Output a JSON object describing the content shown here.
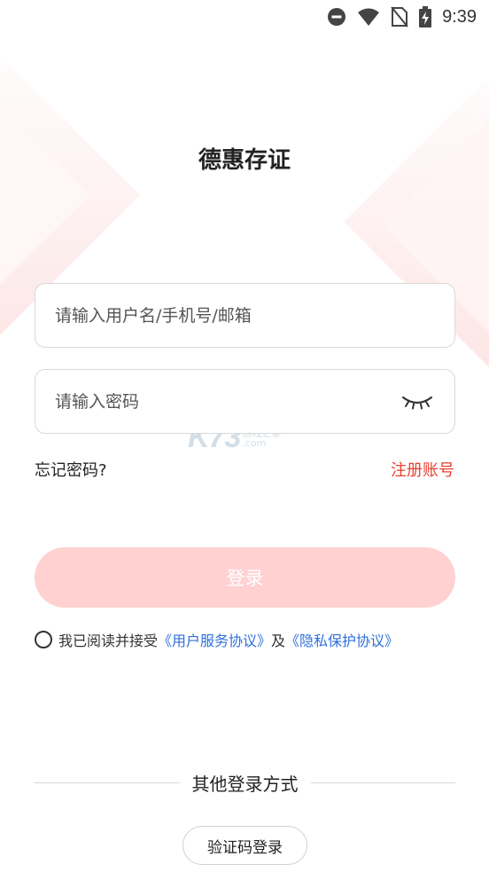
{
  "status_bar": {
    "time": "9:39",
    "icons": [
      "do-not-disturb-icon",
      "wifi-icon",
      "no-sim-icon",
      "battery-charging-icon"
    ]
  },
  "app": {
    "title": "德惠存证"
  },
  "form": {
    "username_placeholder": "请输入用户名/手机号/邮箱",
    "password_placeholder": "请输入密码",
    "password_toggle_icon": "eye-closed-icon"
  },
  "links": {
    "forgot": "忘记密码?",
    "register": "注册账号"
  },
  "login_button": "登录",
  "agreement": {
    "prefix": "我已阅读并接受",
    "user_agreement": "《用户服务协议》",
    "joiner": "及",
    "privacy_policy": "《隐私保护协议》",
    "checked": false
  },
  "other_login": {
    "label": "其他登录方式",
    "sms_button": "验证码登录"
  },
  "watermark": {
    "logo": "K73",
    "line1": "游戏之家",
    "line2": ".com"
  },
  "colors": {
    "accent_red": "#e8402f",
    "login_button_bg": "#ffd1d1",
    "link_blue": "#2f6fdb"
  }
}
